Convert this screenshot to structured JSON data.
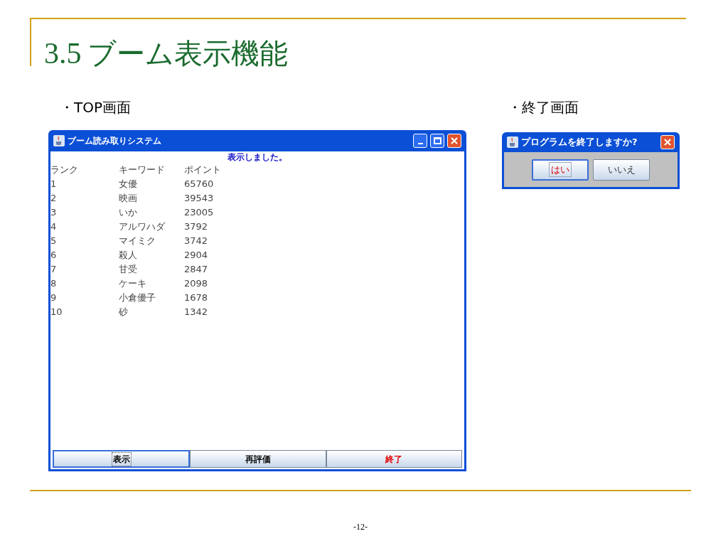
{
  "slide": {
    "title_number": "3.5",
    "title_text": "ブーム表示機能",
    "page_number": "-12-"
  },
  "top_section": {
    "label": "・TOP画面"
  },
  "exit_section": {
    "label": "・終了画面"
  },
  "main_window": {
    "title": "ブーム読み取りシステム",
    "status": "表示しました。",
    "columns": [
      "ランク",
      "キーワード",
      "ポイント"
    ],
    "rows": [
      [
        "1",
        "女優",
        "65760"
      ],
      [
        "2",
        "映画",
        "39543"
      ],
      [
        "3",
        "いか",
        "23005"
      ],
      [
        "4",
        "アルワハダ",
        "3792"
      ],
      [
        "5",
        "マイミク",
        "3742"
      ],
      [
        "6",
        "殺人",
        "2904"
      ],
      [
        "7",
        "甘受",
        "2847"
      ],
      [
        "8",
        "ケーキ",
        "2098"
      ],
      [
        "9",
        "小倉優子",
        "1678"
      ],
      [
        "10",
        "砂",
        "1342"
      ]
    ],
    "buttons": [
      {
        "label": "表示",
        "focused": true,
        "warning": false
      },
      {
        "label": "再評価",
        "focused": false,
        "warning": false
      },
      {
        "label": "終了",
        "focused": false,
        "warning": true
      }
    ]
  },
  "dialog": {
    "title": "プログラムを終了しますか?",
    "buttons": [
      {
        "label": "はい",
        "focused": true,
        "warning": true
      },
      {
        "label": "いいえ",
        "focused": false,
        "warning": false
      }
    ]
  }
}
